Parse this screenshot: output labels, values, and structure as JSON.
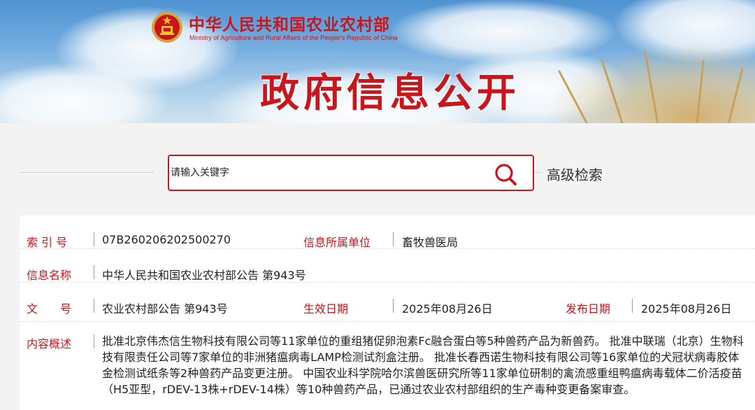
{
  "colors": {
    "brand_red": "#c8161d",
    "label_red": "#c8161d",
    "sky_blue": "#6fa9dd"
  },
  "header": {
    "ministry_cn": "中华人民共和国农业农村部",
    "ministry_en": "Ministry of Agriculture and Rural Affairs of the People's Republic of China",
    "banner_title": "政府信息公开",
    "emblem_icon": "national-emblem-icon"
  },
  "search": {
    "placeholder": "请输入关键字",
    "search_icon": "magnifier-icon",
    "advanced_label": "高级检索"
  },
  "info": {
    "index_label": "索 引 号",
    "index_value": "07B260206202500270",
    "unit_label": "信息所属单位",
    "unit_value": "畜牧兽医局",
    "name_label": "信息名称",
    "name_value": "中华人民共和国农业农村部公告 第943号",
    "doc_label": "文　　号",
    "doc_value": "农业农村部公告 第943号",
    "effective_label": "生效日期",
    "effective_value": "2025年08月26日",
    "publish_label": "发布日期",
    "publish_value": "2025年08月26日",
    "summary_label": "内容概述",
    "summary_value": "批准北京伟杰信生物科技有限公司等11家单位的重组猪促卵泡素Fc融合蛋白等5种兽药产品为新兽药。 批准中联瑞（北京）生物科技有限责任公司等7家单位的非洲猪瘟病毒LAMP检测试剂盒注册。 批准长春西诺生物科技有限公司等16家单位的犬冠状病毒胶体金检测试纸条等2种兽药产品变更注册。 中国农业科学院哈尔滨兽医研究所等11家单位研制的禽流感重组鸭瘟病毒载体二价活疫苗（H5亚型，rDEV-13株+rDEV-14株）等10种兽药产品，已通过农业农村部组织的生产毒种变更备案审查。"
  }
}
